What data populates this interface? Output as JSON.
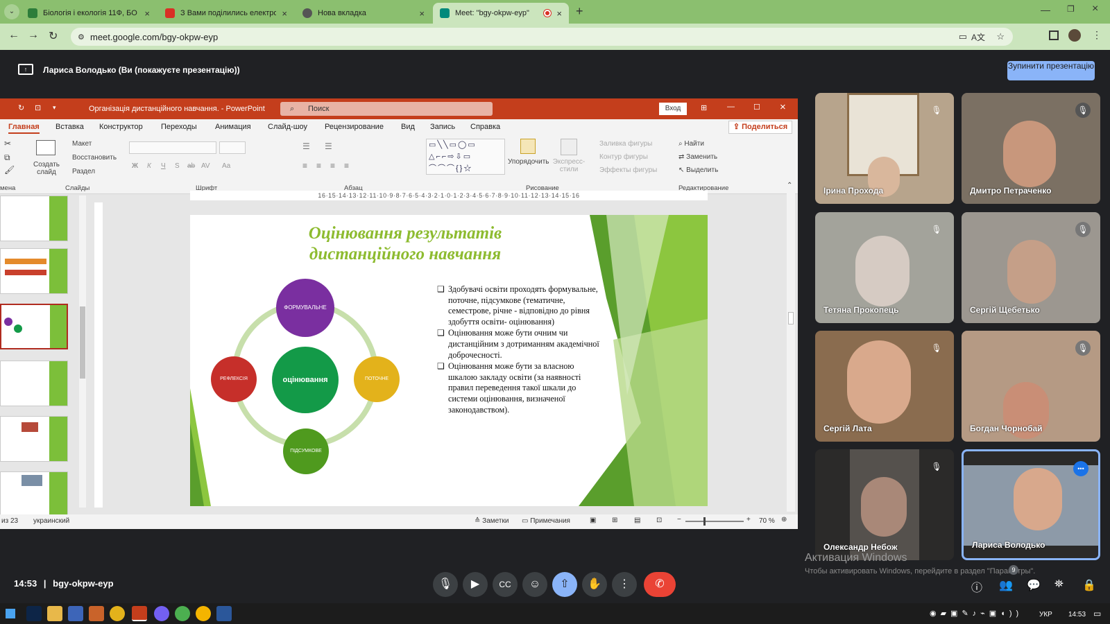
{
  "browser": {
    "tabs": [
      {
        "title": "Біологія і екологія 11Ф, БО",
        "fav": "#2d7d3a"
      },
      {
        "title": "З Вами поділились електронн",
        "fav": "#d93025"
      },
      {
        "title": "Нова вкладка",
        "fav": "#555"
      },
      {
        "title": "Meet: \"bgy-okpw-eyp\"",
        "fav": "#00897b"
      }
    ],
    "url": "meet.google.com/bgy-okpw-eyp"
  },
  "meet": {
    "presenting_text": "Лариса Володько (Ви (покажуєте презентацію))",
    "stop_button": "Зупинити презентацію",
    "time": "14:53",
    "separator": "|",
    "code": "bgy-okpw-eyp",
    "participants": [
      {
        "name": "Ірина Прохода",
        "bg": "#b7a48c",
        "muted": true
      },
      {
        "name": "Дмитро Петраченко",
        "bg": "#7b7063",
        "muted": true
      },
      {
        "name": "Тетяна Прокопець",
        "bg": "#a3a39b",
        "muted": true
      },
      {
        "name": "Сергій Щебетько",
        "bg": "#9c9790",
        "muted": true
      },
      {
        "name": "Сергій Лата",
        "bg": "#8a6c4f",
        "muted": true
      },
      {
        "name": "Богдан Чорнобай",
        "bg": "#b59a84",
        "muted": true
      },
      {
        "name": "Олександр Небож",
        "bg": "#55514d",
        "muted": true
      },
      {
        "name": "Лариса Володько",
        "bg": "#8d9aa8",
        "muted": false
      }
    ],
    "watermark_title": "Активация Windows",
    "watermark_text": "Чтобы активировать Windows, перейдите в раздел \"Параметры\".",
    "badge": "9",
    "more_icon": "•••"
  },
  "ppt": {
    "title": "Організація дистанційного навчання.  -  PowerPoint",
    "search": "Поиск",
    "signin": "Вход",
    "tabs": [
      "Главная",
      "Вставка",
      "Конструктор",
      "Переходы",
      "Анимация",
      "Слайд-шоу",
      "Рецензирование",
      "Вид",
      "Запись",
      "Справка"
    ],
    "share": "Поделиться",
    "ribbon": {
      "layout": "Макет",
      "reset": "Восстановить",
      "section": "Раздел",
      "new_slide": "Создать слайд",
      "arrange": "Упорядочить",
      "quick_styles": "Экспресс-стили",
      "shape_fill": "Заливка фигуры",
      "shape_outline": "Контур фигуры",
      "shape_effects": "Эффекты фигуры",
      "find": "Найти",
      "replace": "Заменить",
      "select": "Выделить",
      "groups": [
        "мена",
        "Слайды",
        "Шрифт",
        "Абзац",
        "Рисование",
        "Редактирование"
      ],
      "font_buttons": [
        "Ж",
        "К",
        "Ч",
        "S",
        "ab",
        "AV",
        "Aa"
      ]
    },
    "ruler": "16·15·14·13·12·11·10·9·8·7·6·5·4·3·2·1·0·1·2·3·4·5·6·7·8·9·10·11·12·13·14·15·16",
    "slide": {
      "title_line1": "Оцінювання результатів",
      "title_line2": "дистанційного навчання",
      "center": "оцінювання",
      "top": "ФОРМУВАЛЬНЕ",
      "right": "ПОТОЧНЕ",
      "bottom": "ПІДСУМКОВЕ",
      "left": "РЕФЛЕКСІЯ",
      "bullets": [
        "Здобувачі освіти проходять формувальне, поточне, підсумкове (тематичне, семестрове, річне - відповідно до рівня здобуття освіти- оцінювання)",
        "Оцінювання може бути очним чи дистанційним з дотриманням академічної доброчесності.",
        "Оцінювання може бути за власною шкалою закладу освіти (за наявності правил переведення такої шкали до системи оцінювання, визначеної законодавством)."
      ]
    },
    "status": {
      "slide_of": "из 23",
      "lang": "украинский",
      "notes": "Заметки",
      "comments": "Примечания",
      "zoom": "70 %"
    }
  },
  "taskbar": {
    "lang": "УКР",
    "time": "14:53"
  },
  "colors": {
    "purple": "#7a2fa0",
    "red": "#c62f2a",
    "yellow": "#e3b21b",
    "green": "#139a48",
    "olive": "#4f9a1e"
  }
}
